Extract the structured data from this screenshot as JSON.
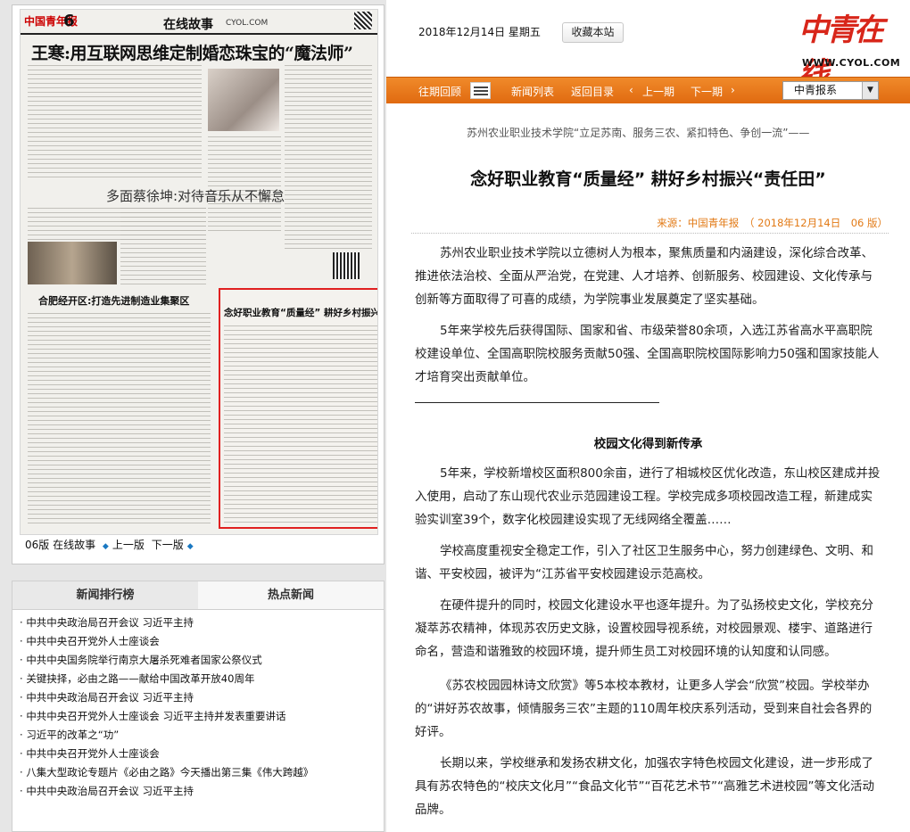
{
  "paper": {
    "logo": "中国青年报",
    "page_number": "6",
    "section": "在线故事",
    "url": "CYOL.COM",
    "headline": "王寒:用互联网思维定制婚恋珠宝的“魔法师”",
    "subheadline": "多面蔡徐坤:对待音乐从不懈怠",
    "left_box_title": "合肥经开区:打造先进制造业集聚区",
    "right_box_title": "念好职业教育“质量经” 耕好乡村振兴“责任田”",
    "caption": {
      "page": "06版 在线故事",
      "prev": "上一版",
      "next": "下一版"
    }
  },
  "rank": {
    "tabs": [
      "新闻排行榜",
      "热点新闻"
    ],
    "items": [
      "中共中央政治局召开会议 习近平主持",
      "中共中央召开党外人士座谈会",
      "中共中央国务院举行南京大屠杀死难者国家公祭仪式",
      "关键抉择，必由之路——献给中国改革开放40周年",
      "中共中央政治局召开会议 习近平主持",
      "中共中央召开党外人士座谈会 习近平主持并发表重要讲话",
      "习近平的改革之“功”",
      "中共中央召开党外人士座谈会",
      "八集大型政论专题片《必由之路》今天播出第三集《伟大跨越》",
      "中共中央政治局召开会议 习近平主持"
    ]
  },
  "topbar": {
    "date": "2018年12月14日 星期五",
    "bookmark_label": "收藏本站",
    "logo_text": "中青在线",
    "logo_url": "WWW.CYOL.COM"
  },
  "nav": {
    "archive": "往期回顾",
    "news_list": "新闻列表",
    "back_to_toc": "返回目录",
    "prev_issue": "上一期",
    "next_issue": "下一期",
    "paper_select": "中青报系"
  },
  "article": {
    "kicker": "苏州农业职业技术学院“立足苏南、服务三农、紧扣特色、争创一流”——",
    "title": "念好职业教育“质量经” 耕好乡村振兴“责任田”",
    "source": "来源：中国青年报　（ 2018年12月14日　06 版）",
    "paragraphs": [
      "苏州农业职业技术学院以立德树人为根本，聚焦质量和内涵建设，深化综合改革、推进依法治校、全面从严治党，在党建、人才培养、创新服务、校园建设、文化传承与创新等方面取得了可喜的成绩，为学院事业发展奠定了坚实基础。",
      "5年来学校先后获得国际、国家和省、市级荣誉80余项，入选江苏省高水平高职院校建设单位、全国高职院校服务贡献50强、全国高职院校国际影响力50强和国家技能人才培育突出贡献单位。"
    ],
    "subhead": "校园文化得到新传承",
    "body": [
      "5年来，学校新增校区面积800余亩，进行了相城校区优化改造，东山校区建成并投入使用，启动了东山现代农业示范园建设工程。学校完成多项校园改造工程，新建成实验实训室39个，数字化校园建设实现了无线网络全覆盖……",
      "学校高度重视安全稳定工作，引入了社区卫生服务中心，努力创建绿色、文明、和谐、平安校园，被评为“江苏省平安校园建设示范高校。",
      "在硬件提升的同时，校园文化建设水平也逐年提升。为了弘扬校史文化，学校充分凝萃苏农精神，体现苏农历史文脉，设置校园导视系统，对校园景观、楼宇、道路进行命名，营造和谐雅致的校园环境，提升师生员工对校园环境的认知度和认同感。",
      "《苏农校园园林诗文欣赏》等5本校本教材，让更多人学会“欣赏”校园。学校举办的“讲好苏农故事，倾情服务三农”主题的110周年校庆系列活动，受到来自社会各界的好评。",
      "长期以来，学校继承和发扬农耕文化，加强农字特色校园文化建设，进一步形成了具有苏农特色的“校庆文化月”“食品文化节”“百花艺术节”“高雅艺术进校园”等文化活动品牌。"
    ]
  },
  "colors": {
    "nav_orange": "#e87818",
    "source_orange": "#e27a16",
    "highlight_red": "#e02020",
    "logo_red": "#d8261a"
  }
}
